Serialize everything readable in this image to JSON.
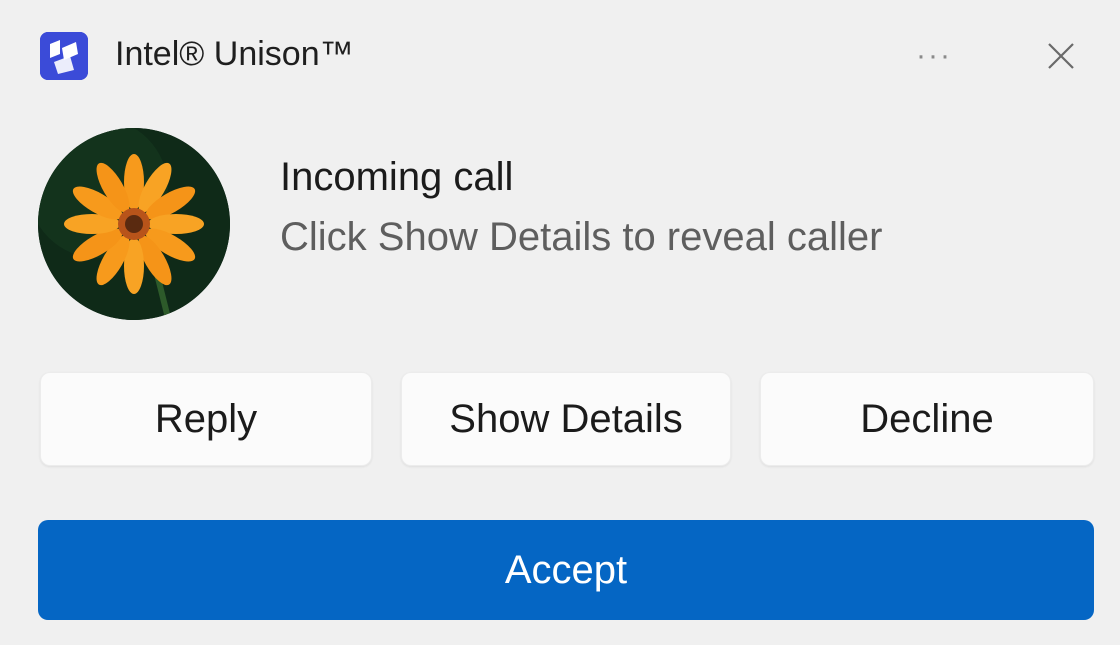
{
  "header": {
    "app_name": "Intel® Unison™",
    "app_icon": "intel-unison-logo",
    "more_label": "···",
    "close_icon": "close-icon",
    "app_icon_color": "#3b4bd8"
  },
  "notification": {
    "title": "Incoming call",
    "message": "Click Show Details to reveal caller",
    "avatar": "orange-flower-image"
  },
  "actions": {
    "reply_label": "Reply",
    "show_details_label": "Show Details",
    "decline_label": "Decline",
    "accept_label": "Accept",
    "accent_color": "#0566c4"
  }
}
